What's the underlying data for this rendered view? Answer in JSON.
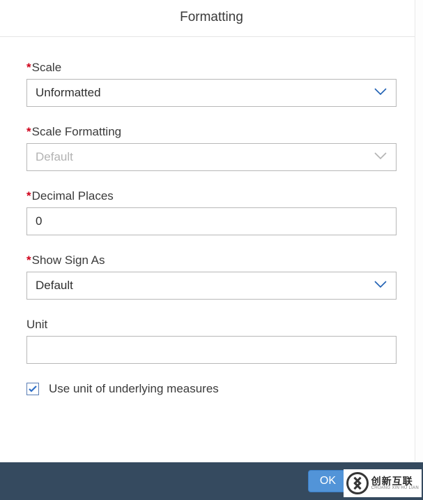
{
  "header": {
    "title": "Formatting"
  },
  "fields": {
    "scale": {
      "label": "Scale",
      "value": "Unformatted"
    },
    "scale_formatting": {
      "label": "Scale Formatting",
      "value": "Default"
    },
    "decimal_places": {
      "label": "Decimal Places",
      "value": "0"
    },
    "show_sign": {
      "label": "Show Sign As",
      "value": "Default"
    },
    "unit": {
      "label": "Unit",
      "value": ""
    },
    "use_unit_checkbox": {
      "label": "Use unit of underlying measures",
      "checked": true
    }
  },
  "footer": {
    "ok": "OK"
  },
  "logo": {
    "cn": "创新互联",
    "en": "CHUANG XIN HU LIAN"
  }
}
